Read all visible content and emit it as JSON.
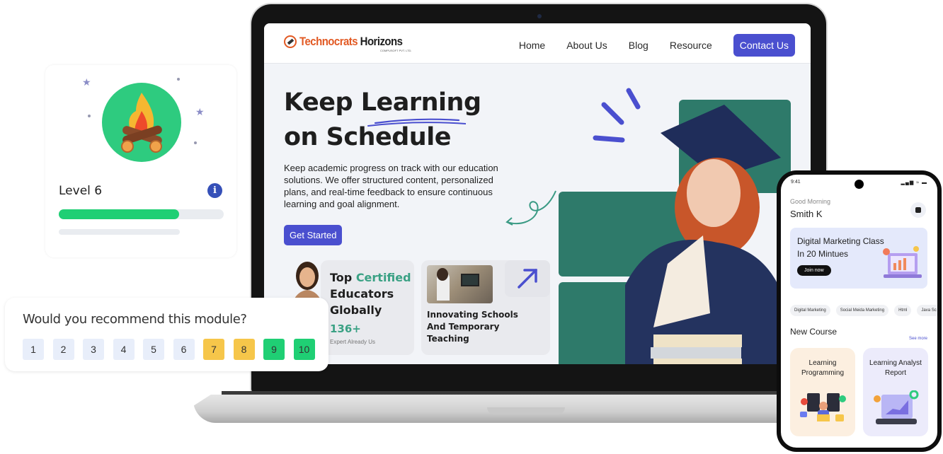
{
  "website": {
    "logo": {
      "brand_primary": "Technocrats",
      "brand_secondary": "Horizons",
      "subtitle": "COMPUSOFT PVT. LTD."
    },
    "nav": {
      "links": [
        "Home",
        "About Us",
        "Blog",
        "Resource"
      ],
      "cta": "Contact Us"
    },
    "hero": {
      "title_line1": "Keep Learning",
      "title_line2": "on Schedule",
      "description": "Keep academic progress on track with our education solutions. We offer structured content, personalized plans, and real-time feedback to ensure continuous learning and goal alignment.",
      "cta": "Get Started"
    },
    "educators_card": {
      "title_word1": "Top",
      "title_accent": "Certified",
      "title_line2": "Educators",
      "title_line3": "Globally",
      "stat": "136+",
      "stat_label": "Expert Already Us"
    },
    "schools_card": {
      "title_line1": "Innovating Schools",
      "title_line2": "And Temporary",
      "title_line3": "Teaching"
    }
  },
  "level_card": {
    "title": "Level 6",
    "progress_fraction": 0.73
  },
  "recommend_card": {
    "question": "Would you recommend this module?",
    "options": [
      {
        "label": "1",
        "tier": "low"
      },
      {
        "label": "2",
        "tier": "low"
      },
      {
        "label": "3",
        "tier": "low"
      },
      {
        "label": "4",
        "tier": "low"
      },
      {
        "label": "5",
        "tier": "low"
      },
      {
        "label": "6",
        "tier": "low"
      },
      {
        "label": "7",
        "tier": "mid"
      },
      {
        "label": "8",
        "tier": "mid"
      },
      {
        "label": "9",
        "tier": "high"
      },
      {
        "label": "10",
        "tier": "high"
      }
    ]
  },
  "phone": {
    "time": "9:41",
    "status_icons": "signal wifi battery",
    "greeting": "Good Morning",
    "user_name": "Smith K",
    "promo": {
      "title_line1": "Digital Marketing Class",
      "title_line2": "In 20 Mintues",
      "cta": "Join now"
    },
    "chips": [
      "Digital Marketing",
      "Social Meida Marketing",
      "Html",
      "Java Sc"
    ],
    "section_title": "New Course",
    "see_more": "See more",
    "courses": [
      {
        "title_line1": "Learning",
        "title_line2": "Programming"
      },
      {
        "title_line1": "Learning Analyst",
        "title_line2": "Report"
      }
    ]
  },
  "colors": {
    "accent": "#4a4fcf",
    "brand_orange": "#e25a24",
    "teal": "#2e7a6a",
    "green": "#1fcf74",
    "amber": "#f6c64a"
  }
}
